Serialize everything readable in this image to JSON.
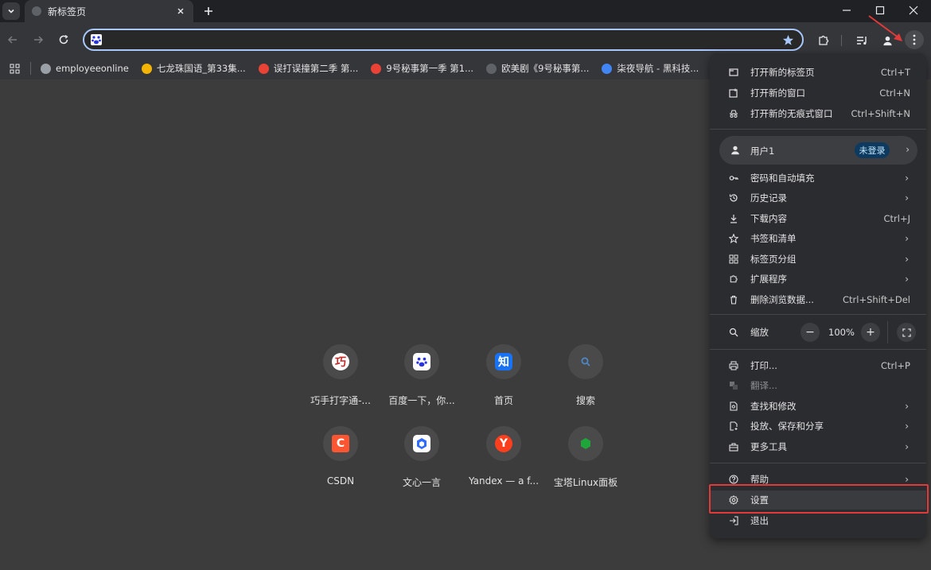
{
  "tab": {
    "title": "新标签页"
  },
  "omnibox": {
    "value": ""
  },
  "bookmarks": [
    {
      "label": "employeeonline",
      "color": "#9aa0a6"
    },
    {
      "label": "七龙珠国语_第33集...",
      "color": "#f4b400"
    },
    {
      "label": "误打误撞第二季 第...",
      "color": "#ea4335"
    },
    {
      "label": "9号秘事第一季 第1...",
      "color": "#ea4335"
    },
    {
      "label": "欧美剧《9号秘事第...",
      "color": "#5f6368"
    },
    {
      "label": "柒夜导航 - 黑科技...",
      "color": "#4285f4"
    }
  ],
  "shortcuts": [
    {
      "label": "巧手打字通-...",
      "icon": "typing-app-icon",
      "bg": "#ffffff",
      "text": "巧"
    },
    {
      "label": "百度一下，你...",
      "icon": "baidu-paw-icon",
      "bg": "#ffffff",
      "text": ""
    },
    {
      "label": "首页",
      "icon": "zhihu-icon",
      "bg": "#1772f6",
      "text": "知"
    },
    {
      "label": "搜索",
      "icon": "search-icon",
      "bg": "#4a4a4a",
      "text": ""
    },
    {
      "label": "CSDN",
      "icon": "csdn-icon",
      "bg": "#fc5531",
      "text": "C"
    },
    {
      "label": "文心一言",
      "icon": "wenxin-icon",
      "bg": "#ffffff",
      "text": ""
    },
    {
      "label": "Yandex — a f...",
      "icon": "yandex-icon",
      "bg": "#fc3f1d",
      "text": "Y"
    },
    {
      "label": "宝塔Linux面板",
      "icon": "baota-icon",
      "bg": "#20a53a",
      "text": ""
    }
  ],
  "menu": {
    "new_tab": {
      "label": "打开新的标签页",
      "shortcut": "Ctrl+T"
    },
    "new_window": {
      "label": "打开新的窗口",
      "shortcut": "Ctrl+N"
    },
    "incognito": {
      "label": "打开新的无痕式窗口",
      "shortcut": "Ctrl+Shift+N"
    },
    "profile": {
      "name": "用户1",
      "badge": "未登录"
    },
    "passwords": {
      "label": "密码和自动填充"
    },
    "history": {
      "label": "历史记录"
    },
    "downloads": {
      "label": "下载内容",
      "shortcut": "Ctrl+J"
    },
    "bookmarks": {
      "label": "书签和清单"
    },
    "tab_groups": {
      "label": "标签页分组"
    },
    "extensions": {
      "label": "扩展程序"
    },
    "clear_data": {
      "label": "删除浏览数据...",
      "shortcut": "Ctrl+Shift+Del"
    },
    "zoom": {
      "label": "缩放",
      "value": "100%",
      "minus": "−",
      "plus": "+"
    },
    "print": {
      "label": "打印...",
      "shortcut": "Ctrl+P"
    },
    "translate": {
      "label": "翻译..."
    },
    "find": {
      "label": "查找和修改"
    },
    "cast": {
      "label": "投放、保存和分享"
    },
    "more_tools": {
      "label": "更多工具"
    },
    "help": {
      "label": "帮助"
    },
    "settings": {
      "label": "设置"
    },
    "exit": {
      "label": "退出"
    }
  },
  "colors": {
    "accent": "#a8c7fa",
    "highlight": "#e03a3a"
  }
}
